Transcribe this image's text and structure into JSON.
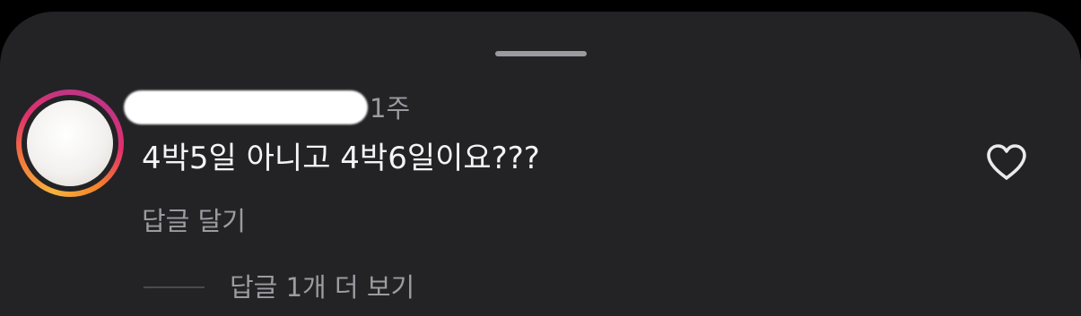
{
  "comment": {
    "username_redacted": true,
    "timestamp": "1주",
    "text": "4박5일 아니고 4박6일이요???",
    "reply_label": "답글 달기",
    "view_more_replies_label": "답글 1개 더 보기"
  },
  "icons": {
    "grabber": "sheet-grabber",
    "like": "heart-outline-icon",
    "avatar": "avatar-with-story-ring"
  },
  "colors": {
    "sheet_background": "#232326",
    "primary_text": "#f4f4f6",
    "secondary_text": "#9b9ba1",
    "story_ring_start": "#f6b23d",
    "story_ring_end": "#c13584"
  }
}
